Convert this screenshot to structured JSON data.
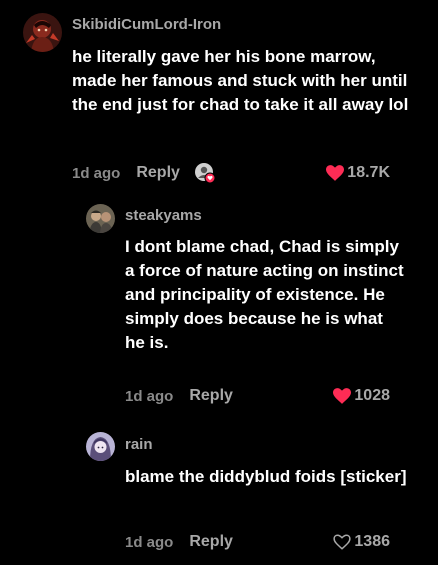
{
  "colors": {
    "background": "#000000",
    "username": "#a8a8a8",
    "text": "#ffffff",
    "meta": "#8a8a8a",
    "liked_heart": "#fe2c55"
  },
  "comments": [
    {
      "username": "SkibidiCumLord-Iron",
      "text": "he literally gave her his bone marrow, made her famous and stuck with her until the end just for chad to take it all away lol",
      "time": "1d ago",
      "reply_label": "Reply",
      "likes": "18.7K",
      "liked": true,
      "liked_by_creator": true,
      "like_icon": "heart-filled-icon"
    },
    {
      "username": "steakyams",
      "text": "I dont blame chad, Chad is simply a force of nature acting on instinct and principality of existence. He simply does because he is what he is.",
      "time": "1d ago",
      "reply_label": "Reply",
      "likes": "1028",
      "liked": true,
      "like_icon": "heart-filled-icon"
    },
    {
      "username": "rain",
      "text": "blame the diddyblud foids [sticker]",
      "time": "1d ago",
      "reply_label": "Reply",
      "likes": "1386",
      "liked": false,
      "like_icon": "heart-outline-icon"
    }
  ]
}
